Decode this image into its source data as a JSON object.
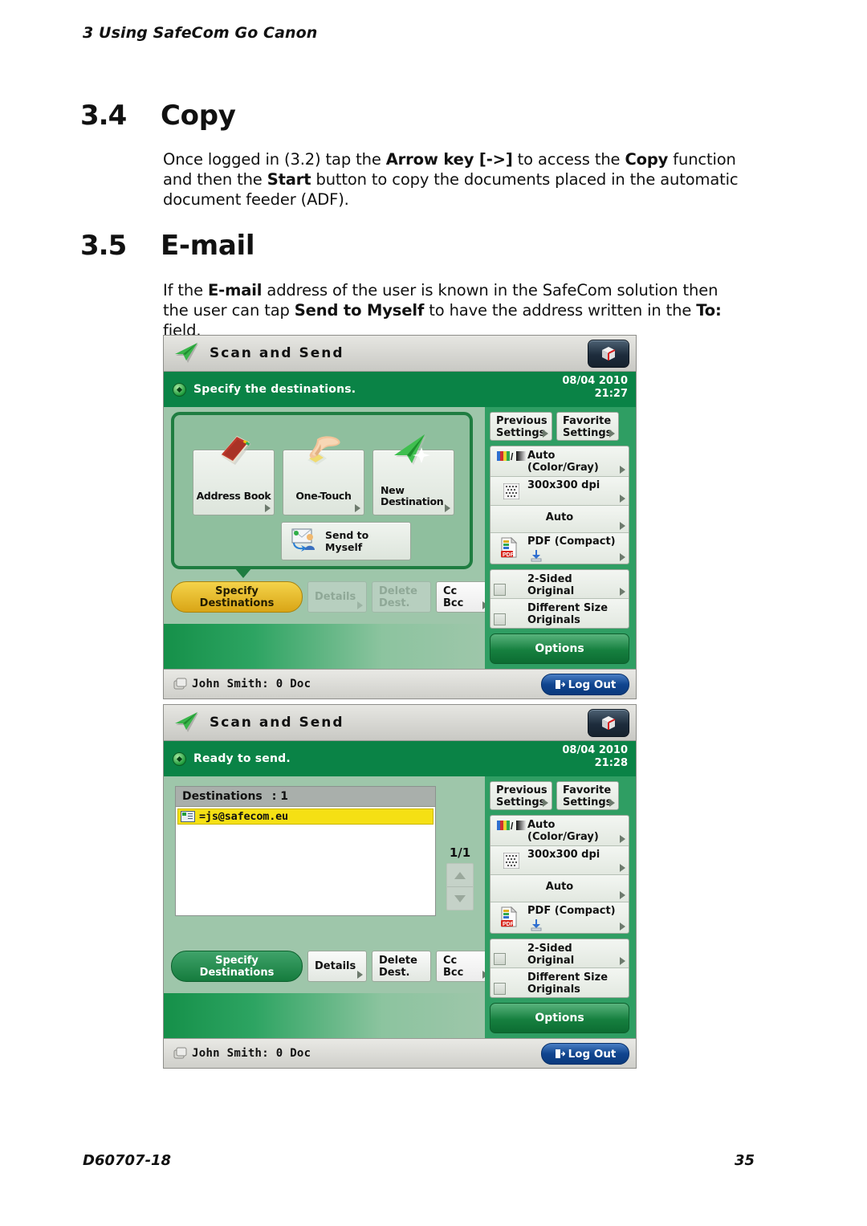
{
  "page": {
    "running_head": "3 Using SafeCom Go Canon",
    "footer_doc_id": "D60707-18",
    "footer_page_number": "35"
  },
  "sections": [
    {
      "number": "3.4",
      "title": "Copy",
      "body_html": "Once logged in (3.2) tap the <b>Arrow key [-&gt;]</b> to access the <b>Copy</b> function and then the <b>Start</b> button to copy the documents placed in the automatic document feeder (ADF)."
    },
    {
      "number": "3.5",
      "title": "E-mail",
      "body_html": "If the <b>E-mail</b> address of the user is known in the SafeCom solution then the user can tap <b>Send to Myself</b> to have the address written in the <b>To:</b> field."
    }
  ],
  "screenshot1": {
    "title": "Scan and Send",
    "status_message": "Specify the destinations.",
    "date": "08/04 2010",
    "time": "21:27",
    "destination_buttons": [
      {
        "label": "Address Book",
        "icon": "address-book-icon"
      },
      {
        "label": "One-Touch",
        "icon": "hand-touch-icon"
      },
      {
        "label_line1": "New",
        "label_line2": "Destination",
        "icon": "paper-plane-icon"
      }
    ],
    "send_to_myself": {
      "label_line1": "Send to",
      "label_line2": "Myself",
      "icon": "send-to-myself-icon"
    },
    "tabs": [
      {
        "label_line1": "Specify",
        "label_line2": "Destinations",
        "state": "active-yellow"
      },
      {
        "label_line1": "Details",
        "label_line2": "",
        "state": "disabled"
      },
      {
        "label_line1": "Delete",
        "label_line2": "Dest.",
        "state": "disabled"
      },
      {
        "label_line1": "Cc",
        "label_line2": "Bcc",
        "state": "normal"
      }
    ],
    "settings": {
      "previous_settings": "Previous Settings",
      "favorite_settings": "Favorite Settings",
      "color_mode_line1": "Auto",
      "color_mode_line2": "(Color/Gray)",
      "resolution": "300x300 dpi",
      "scan_size": "Auto",
      "file_format": "PDF (Compact)",
      "two_sided_line1": "2-Sided",
      "two_sided_line2": "Original",
      "different_size_line1": "Different Size",
      "different_size_line2": "Originals",
      "options_button": "Options"
    },
    "footer": {
      "user": "John Smith: 0 Doc",
      "logout": "Log Out"
    }
  },
  "screenshot2": {
    "title": "Scan and Send",
    "status_message": "Ready to send.",
    "date": "08/04 2010",
    "time": "21:28",
    "destinations_label": "Destinations",
    "destinations_count": ": 1",
    "destination_entries": [
      "=js@safecom.eu"
    ],
    "page_indicator": "1/1",
    "tabs": [
      {
        "label_line1": "Specify",
        "label_line2": "Destinations",
        "state": "active-green"
      },
      {
        "label_line1": "Details",
        "label_line2": "",
        "state": "normal"
      },
      {
        "label_line1": "Delete",
        "label_line2": "Dest.",
        "state": "normal"
      },
      {
        "label_line1": "Cc",
        "label_line2": "Bcc",
        "state": "normal"
      }
    ],
    "settings": {
      "previous_settings": "Previous Settings",
      "favorite_settings": "Favorite Settings",
      "color_mode_line1": "Auto",
      "color_mode_line2": "(Color/Gray)",
      "resolution": "300x300 dpi",
      "scan_size": "Auto",
      "file_format": "PDF (Compact)",
      "two_sided_line1": "2-Sided",
      "two_sided_line2": "Original",
      "different_size_line1": "Different Size",
      "different_size_line2": "Originals",
      "options_button": "Options"
    },
    "footer": {
      "user": "John Smith: 0 Doc",
      "logout": "Log Out"
    }
  },
  "colors": {
    "status_green": "#0a8346",
    "panel_green": "#2f9e63",
    "body_green": "#9ec6aa",
    "accent_yellow": "#d9a516",
    "logout_blue": "#10458f",
    "highlight_yellow": "#f5e014"
  }
}
